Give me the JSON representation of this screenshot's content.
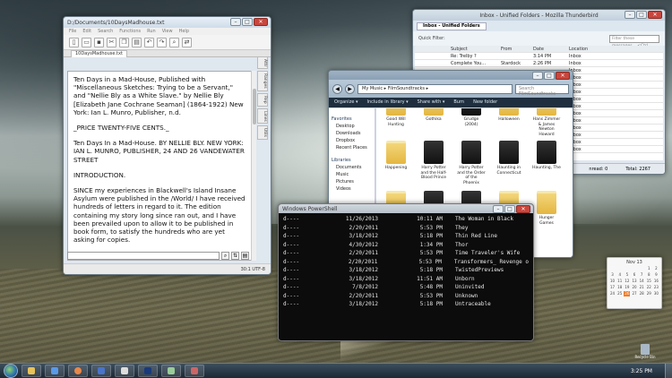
{
  "editor": {
    "title": "D:/Documents/10DaysMadhouse.txt",
    "menu": [
      "File",
      "Edit",
      "Search",
      "Functions",
      "Run",
      "View",
      "Help"
    ],
    "tab": "10DaysMadhouse.txt",
    "side_tabs": [
      "Attr",
      "Ranges",
      "Rep",
      "Lines",
      "Utils"
    ],
    "paragraphs": [
      "Ten Days in a Mad-House, Published with \"Miscellaneous Sketches: Trying to be a Servant,\" and \"Nellie Bly as a White Slave.\" by Nellie Bly [Elizabeth Jane Cochrane Seaman] (1864-1922) New York: Ian L. Munro, Publisher, n.d.",
      "_PRICE TWENTY-FIVE CENTS._",
      "Ten Days In a Mad-House. BY NELLIE BLY. NEW YORK: IAN L. MUNRO, PUBLISHER, 24 AND 26 VANDEWATER STREET",
      "INTRODUCTION.",
      "SINCE my experiences in Blackwell's Island Insane Asylum were published in the /World/ I have received hundreds of letters in regard to it. The edition containing my story long since ran out, and I have been prevailed upon to allow it to be published in book form, to satisfy the hundreds who are yet asking for copies."
    ],
    "status": "30:1  UTF-8"
  },
  "thunderbird": {
    "title": "Inbox - Unified Folders - Mozilla Thunderbird",
    "tab": "Inbox - Unified Folders",
    "quick_filter": "Quick Filter:",
    "search_placeholder": "Filter these messages... <Ctrl",
    "columns": [
      "Subject",
      "From",
      "Date",
      "Location"
    ],
    "rows": [
      {
        "subject": "Re: Trelby ?",
        "from": "",
        "date": "3:14 PM",
        "location": "Inbox"
      },
      {
        "subject": "Complete You...",
        "from": "Stardock",
        "date": "2:26 PM",
        "location": "Inbox"
      },
      {
        "subject": "",
        "from": "",
        "date": "",
        "location": "Inbox"
      },
      {
        "subject": "",
        "from": "",
        "date": "",
        "location": "Inbox"
      },
      {
        "subject": "",
        "from": "",
        "date": "",
        "location": "Inbox"
      },
      {
        "subject": "",
        "from": "",
        "date": "",
        "location": "Inbox"
      },
      {
        "subject": "",
        "from": "",
        "date": "",
        "location": "Inbox"
      },
      {
        "subject": "",
        "from": "",
        "date": "",
        "location": "Inbox"
      },
      {
        "subject": "",
        "from": "",
        "date": "",
        "location": "Inbox"
      },
      {
        "subject": "",
        "from": "",
        "date": "",
        "location": "Inbox"
      },
      {
        "subject": "",
        "from": "",
        "date": "",
        "location": "Inbox"
      },
      {
        "subject": "",
        "from": "",
        "date": "",
        "location": "Inbox"
      },
      {
        "subject": "",
        "from": "",
        "date": "",
        "location": "Inbox"
      },
      {
        "subject": "",
        "from": "",
        "date": "",
        "location": "Inbox"
      }
    ],
    "unread": "nread: 0",
    "total": "Total: 2267"
  },
  "explorer": {
    "address": "My Music ▸ FilmSoundtracks ▸",
    "search": "Search FilmSoundtracks",
    "commands": [
      "Organize ▾",
      "Include in library ▾",
      "Share with ▾",
      "Burn",
      "New folder"
    ],
    "nav": [
      {
        "label": "Favorites",
        "group": true
      },
      {
        "label": "Desktop"
      },
      {
        "label": "Downloads"
      },
      {
        "label": "Dropbox"
      },
      {
        "label": "Recent Places"
      },
      {
        "label": "Libraries",
        "group": true
      },
      {
        "label": "Documents"
      },
      {
        "label": "Music"
      },
      {
        "label": "Pictures"
      },
      {
        "label": "Videos"
      }
    ],
    "files": [
      "Good Will Hunting",
      "Gothika",
      "Grudge (2004)",
      "Halloween",
      "Hans Zimmer & James Newton Howard",
      "Happening",
      "Harry Potter and the Half-Blood Prince",
      "Harry Potter and the Order of the Phoenix",
      "Haunting in Connecticut",
      "Haunting, The",
      "",
      "",
      "",
      "",
      "Hunger Games"
    ]
  },
  "powershell": {
    "title": "Windows PowerShell",
    "rows": [
      {
        "mode": "d----",
        "date": "11/26/2013",
        "time": "10:11 AM",
        "name": "The Woman in Black"
      },
      {
        "mode": "d----",
        "date": "2/20/2011",
        "time": "5:53 PM",
        "name": "They"
      },
      {
        "mode": "d----",
        "date": "3/18/2012",
        "time": "5:18 PM",
        "name": "Thin Red Line"
      },
      {
        "mode": "d----",
        "date": "4/30/2012",
        "time": "1:34 PM",
        "name": "Thor"
      },
      {
        "mode": "d----",
        "date": "2/20/2011",
        "time": "5:53 PM",
        "name": "Time Traveler's Wife"
      },
      {
        "mode": "d----",
        "date": "2/20/2011",
        "time": "5:53 PM",
        "name": "Transformers_ Revenge o"
      },
      {
        "mode": "d----",
        "date": "3/18/2012",
        "time": "5:18 PM",
        "name": "TwistedPreviews"
      },
      {
        "mode": "d----",
        "date": "3/18/2012",
        "time": "11:51 AM",
        "name": "Unborn"
      },
      {
        "mode": "d----",
        "date": "7/8/2012",
        "time": "5:48 PM",
        "name": "Uninvited"
      },
      {
        "mode": "d----",
        "date": "2/20/2011",
        "time": "5:53 PM",
        "name": "Unknown"
      },
      {
        "mode": "d----",
        "date": "3/18/2012",
        "time": "5:18 PM",
        "name": "Untraceable"
      }
    ]
  },
  "calendar": {
    "month": "Nov 13",
    "days": [
      "1",
      "2",
      "3",
      "4",
      "5",
      "6",
      "7",
      "8",
      "9",
      "10",
      "11",
      "12",
      "13",
      "14",
      "15",
      "16",
      "17",
      "18",
      "19",
      "20",
      "21",
      "22",
      "23",
      "24",
      "25",
      "26",
      "27",
      "28",
      "29",
      "30"
    ],
    "today": "26"
  },
  "desktop": {
    "recycle_bin": "Recycle Bin"
  },
  "taskbar": {
    "time": "3:25 PM"
  }
}
